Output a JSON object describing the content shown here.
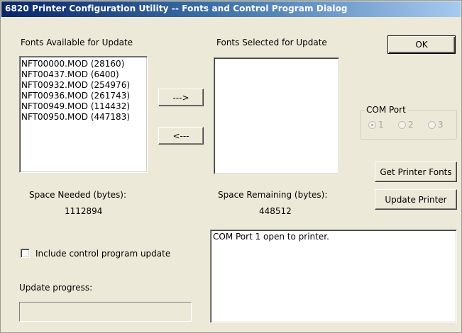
{
  "window": {
    "title": "6820 Printer Configuration Utility -- Fonts and Control Program Dialog"
  },
  "fonts_available": {
    "label": "Fonts Available for Update",
    "items": [
      "NFT00000.MOD (28160)",
      "NFT00437.MOD (6400)",
      "NFT00932.MOD (254976)",
      "NFT00936.MOD (261743)",
      "NFT00949.MOD (114432)",
      "NFT00950.MOD (447183)"
    ]
  },
  "fonts_selected": {
    "label": "Fonts Selected for Update",
    "items": []
  },
  "buttons": {
    "add": "--->",
    "remove": "<---",
    "ok": "OK",
    "get_printer_fonts": "Get Printer Fonts",
    "update_printer": "Update Printer"
  },
  "com_port": {
    "label": "COM Port",
    "options": [
      "1",
      "2",
      "3"
    ],
    "selected": "1"
  },
  "space_needed": {
    "label": "Space Needed (bytes):",
    "value": "1112894"
  },
  "space_remaining": {
    "label": "Space Remaining (bytes):",
    "value": "448512"
  },
  "control_program": {
    "label": "Include control program update",
    "checked": false
  },
  "progress": {
    "label": "Update progress:",
    "value": 0
  },
  "status": {
    "text": "COM Port 1 open to printer."
  },
  "colors": {
    "dialog_bg": "#ece9d8",
    "title_start": "#0a246a",
    "title_end": "#a6caf0"
  }
}
